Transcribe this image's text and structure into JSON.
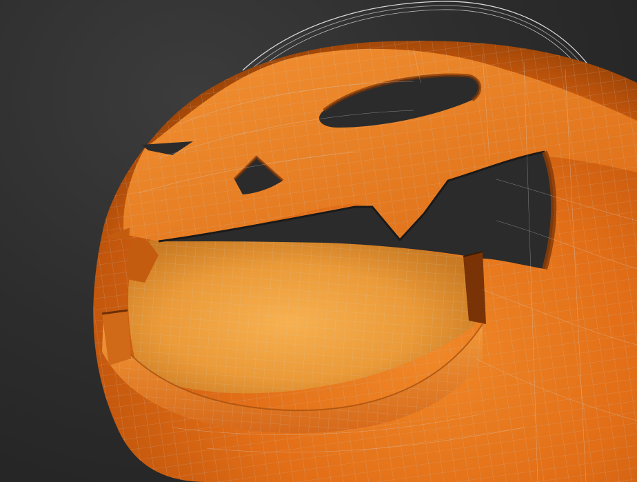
{
  "viewport": {
    "background_color": "#2d2d2d",
    "render_mode": "smooth-shaded-with-wireframe-edges"
  },
  "model": {
    "object": "jack-o-lantern-bucket",
    "material_color": "#e8731a",
    "interior_color": "#f09a3a",
    "shadow_color": "#9a4408",
    "wire_color": "#b9b9b9",
    "handle_wire_color": "#d6d6d6",
    "cutouts": [
      "left-eye",
      "right-eye",
      "nose",
      "mouth"
    ]
  }
}
